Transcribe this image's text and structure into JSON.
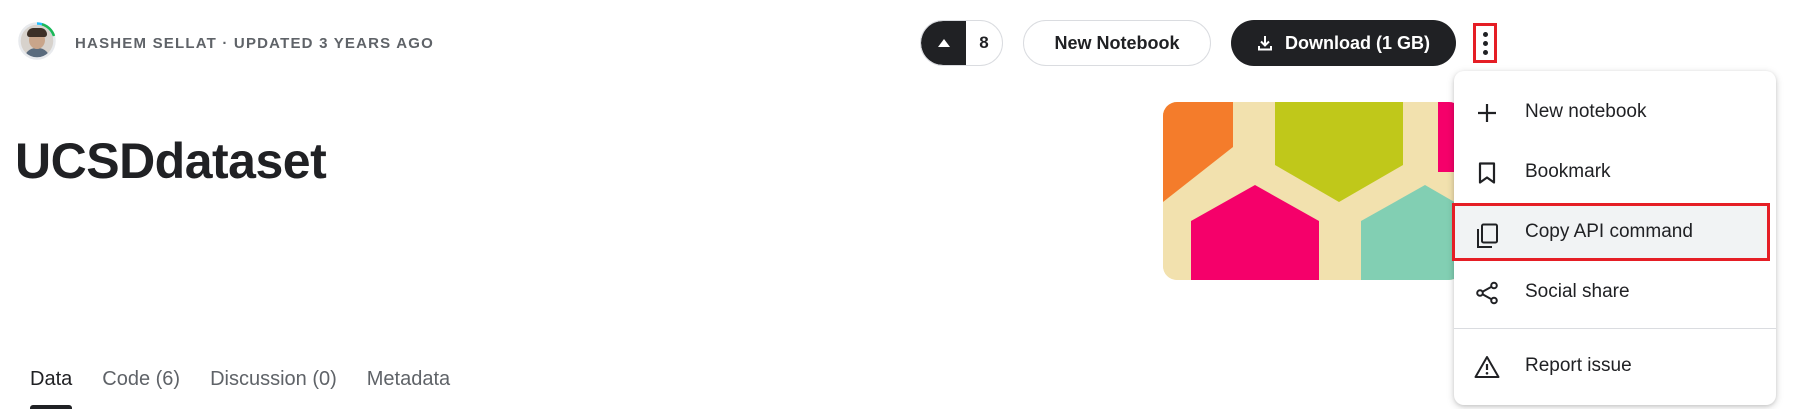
{
  "header": {
    "meta": "HASHEM SELLAT · UPDATED 3 YEARS AGO"
  },
  "actions": {
    "upvote_count": "8",
    "new_notebook_label": "New Notebook",
    "download_label": "Download (1 GB)"
  },
  "dataset": {
    "title": "UCSDdataset"
  },
  "tabs": [
    {
      "label": "Data",
      "active": true
    },
    {
      "label": "Code (6)",
      "active": false
    },
    {
      "label": "Discussion (0)",
      "active": false
    },
    {
      "label": "Metadata",
      "active": false
    }
  ],
  "menu": {
    "items": [
      {
        "label": "New notebook",
        "icon": "plus-icon"
      },
      {
        "label": "Bookmark",
        "icon": "bookmark-icon"
      },
      {
        "label": "Copy API command",
        "icon": "copy-icon",
        "highlighted": true
      },
      {
        "label": "Social share",
        "icon": "share-icon"
      },
      {
        "label": "Report issue",
        "icon": "warning-icon"
      }
    ]
  },
  "colors": {
    "dark": "#202124",
    "highlight_border": "#e51e25",
    "menu_hover": "#f1f3f4",
    "banner_orange": "#f47c2b",
    "banner_lime": "#c0c81a",
    "banner_pink": "#f5006a",
    "banner_mint": "#82cfb3",
    "banner_cream": "#f2e1ae"
  }
}
